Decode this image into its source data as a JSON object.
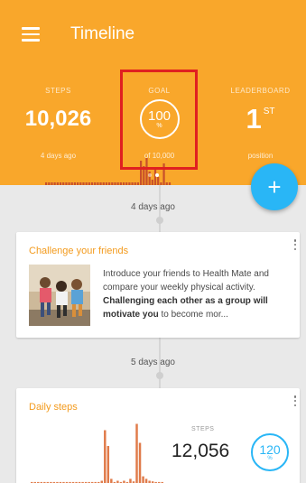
{
  "header": {
    "title": "Timeline",
    "stats": {
      "steps": {
        "label": "STEPS",
        "value": "10,026",
        "sub": "4 days ago"
      },
      "goal": {
        "label": "GOAL",
        "percent": "100",
        "percent_sign": "%",
        "sub": "of 10,000"
      },
      "leaderboard": {
        "label": "LEADERBOARD",
        "rank": "1",
        "rank_suffix": "ST",
        "sub": "position"
      }
    },
    "bar_values": [
      0.1,
      0.1,
      0.1,
      0.1,
      0.1,
      0.1,
      0.1,
      0.1,
      0.1,
      0.1,
      0.1,
      0.1,
      0.1,
      0.1,
      0.1,
      0.1,
      0.1,
      0.1,
      0.1,
      0.1,
      0.1,
      0.1,
      0.1,
      0.1,
      0.1,
      0.1,
      0.1,
      0.1,
      0.1,
      0.1,
      0.1,
      0.1,
      0.1,
      0.9,
      0.7,
      1.0,
      0.5,
      0.2,
      0.6,
      0.3,
      0.1,
      0.8,
      0.1,
      0.1
    ],
    "pager": {
      "pages": 2,
      "active": 1
    },
    "colors": {
      "header": "#f9a72b",
      "fab": "#29b6f6",
      "highlight": "#e02020"
    }
  },
  "fab": {
    "icon": "plus-icon",
    "label": "+"
  },
  "timeline": {
    "date1": "4 days ago",
    "date2": "5 days ago",
    "challenge_card": {
      "title": "Challenge your friends",
      "text_plain": "Introduce your friends to Health Mate and compare your weekly physical activity. ",
      "text_bold": "Challenging each other as a group will motivate you",
      "text_tail": " to become mor..."
    },
    "steps_card": {
      "title": "Daily steps",
      "steps_label": "STEPS",
      "steps_value": "12,056",
      "percent": "120",
      "percent_sign": "%",
      "bar_values": [
        0.03,
        0.03,
        0.03,
        0.03,
        0.03,
        0.03,
        0.03,
        0.03,
        0.03,
        0.03,
        0.03,
        0.03,
        0.03,
        0.03,
        0.03,
        0.03,
        0.03,
        0.03,
        0.03,
        0.03,
        0.03,
        0.03,
        0.05,
        0.85,
        0.6,
        0.08,
        0.03,
        0.05,
        0.03,
        0.05,
        0.03,
        0.08,
        0.04,
        0.95,
        0.65,
        0.12,
        0.08,
        0.05,
        0.04,
        0.03,
        0.03,
        0.03
      ]
    }
  }
}
